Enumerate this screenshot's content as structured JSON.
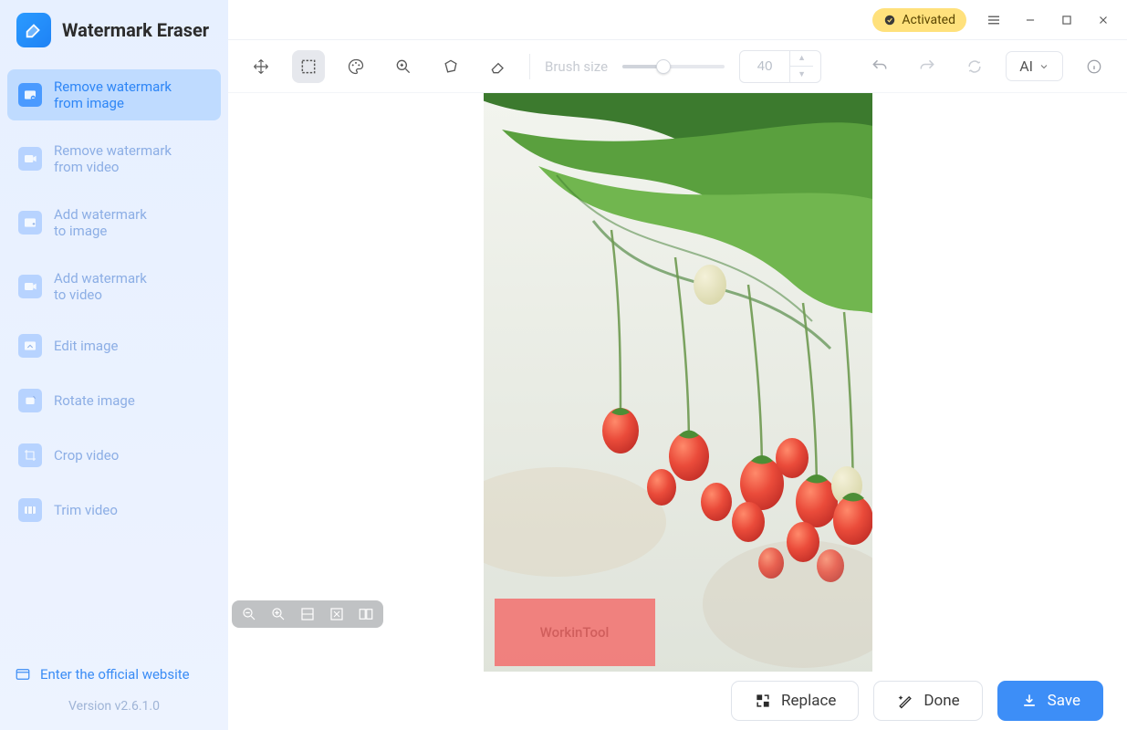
{
  "brand": {
    "title": "Watermark Eraser"
  },
  "sidebar": {
    "items": [
      {
        "label": "Remove watermark\nfrom image",
        "icon": "remove-image-icon",
        "active": true
      },
      {
        "label": "Remove watermark\nfrom video",
        "icon": "remove-video-icon",
        "active": false
      },
      {
        "label": "Add watermark\nto image",
        "icon": "add-image-icon",
        "active": false
      },
      {
        "label": "Add watermark\nto video",
        "icon": "add-video-icon",
        "active": false
      },
      {
        "label": "Edit image",
        "icon": "edit-image-icon",
        "active": false
      },
      {
        "label": "Rotate image",
        "icon": "rotate-image-icon",
        "active": false
      },
      {
        "label": "Crop video",
        "icon": "crop-video-icon",
        "active": false
      },
      {
        "label": "Trim video",
        "icon": "trim-video-icon",
        "active": false
      }
    ],
    "official_link": "Enter the official website",
    "version": "Version v2.6.1.0"
  },
  "titlebar": {
    "activated": "Activated"
  },
  "toolbar": {
    "brush_label": "Brush size",
    "brush_value": "40",
    "ai_label": "AI"
  },
  "canvas": {
    "watermark_text": "WorkinTool"
  },
  "actions": {
    "replace": "Replace",
    "done": "Done",
    "save": "Save"
  }
}
